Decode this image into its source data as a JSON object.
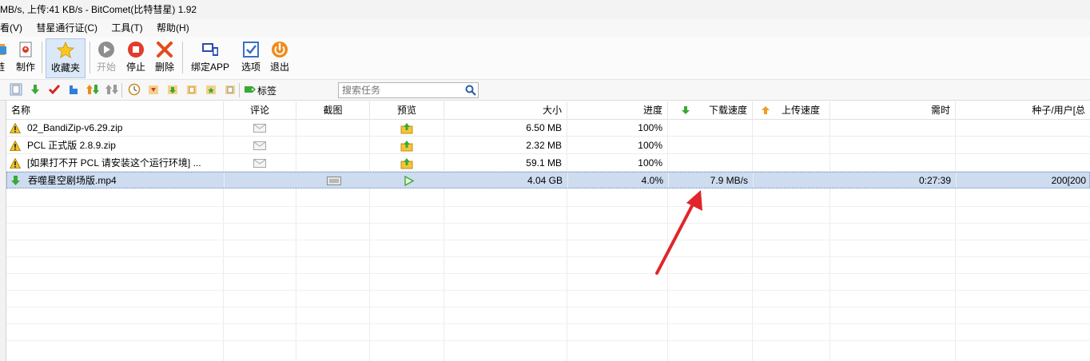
{
  "window": {
    "title": "MB/s, 上传:41 KB/s - BitComet(比特彗星) 1.92"
  },
  "menu": [
    "看(V)",
    "彗星通行证(C)",
    "工具(T)",
    "帮助(H)"
  ],
  "toolbar": {
    "items": [
      {
        "label": "链",
        "icon": "link-icon"
      },
      {
        "label": "制作",
        "icon": "make-torrent-icon"
      },
      {
        "label": "收藏夹",
        "icon": "star-icon"
      },
      {
        "label": "开始",
        "icon": "start-icon"
      },
      {
        "label": "停止",
        "icon": "stop-icon"
      },
      {
        "label": "删除",
        "icon": "delete-icon"
      },
      {
        "label": "绑定APP",
        "icon": "bind-app-icon"
      },
      {
        "label": "选项",
        "icon": "options-icon"
      },
      {
        "label": "退出",
        "icon": "exit-icon"
      }
    ]
  },
  "subtoolbar": {
    "tag_label": "标签",
    "search_placeholder": "搜索任务"
  },
  "table": {
    "columns": [
      "名称",
      "评论",
      "截图",
      "预览",
      "大小",
      "进度",
      "下载速度",
      "上传速度",
      "需时",
      "种子/用户[总"
    ],
    "rows": [
      {
        "icon": "warning-icon",
        "name": "02_BandiZip-v6.29.zip",
        "size": "6.50 MB",
        "progress": "100%",
        "down": "",
        "up": "",
        "eta": "",
        "seeds": ""
      },
      {
        "icon": "warning-icon",
        "name": "PCL 正式版 2.8.9.zip",
        "size": "2.32 MB",
        "progress": "100%",
        "down": "",
        "up": "",
        "eta": "",
        "seeds": ""
      },
      {
        "icon": "warning-icon",
        "name": "[如果打不开 PCL 请安装这个运行环境] ...",
        "size": "59.1 MB",
        "progress": "100%",
        "down": "",
        "up": "",
        "eta": "",
        "seeds": ""
      },
      {
        "icon": "download-arrow-icon",
        "name": "吞噬星空剧场版.mp4",
        "size": "4.04 GB",
        "progress": "4.0%",
        "down": "7.9 MB/s",
        "up": "",
        "eta": "0:27:39",
        "seeds": "200[200"
      }
    ]
  },
  "colors": {
    "accent_arrow": "#e0262b",
    "selection": "#cddcef"
  }
}
